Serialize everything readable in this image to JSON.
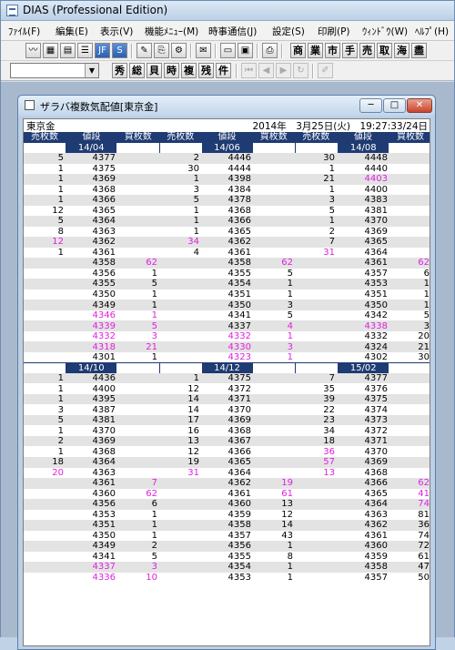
{
  "app": {
    "title": "DIAS (Professional Edition)"
  },
  "menubar": {
    "items": [
      {
        "label": "ﾌｧｲﾙ(F)"
      },
      {
        "label": "編集(E)"
      },
      {
        "label": "表示(V)"
      },
      {
        "label": "機能ﾒﾆｭｰ(M)"
      },
      {
        "label": "時事通信(J)"
      },
      {
        "label": "設定(S)"
      },
      {
        "label": "印刷(P)"
      },
      {
        "label": "ｳｨﾝﾄﾞｳ(W)"
      },
      {
        "label": "ﾍﾙﾌﾟ(H)"
      }
    ]
  },
  "toolbar1": {
    "kanji_buttons": [
      "商",
      "業",
      "市",
      "手",
      "売",
      "取",
      "海",
      "盡"
    ],
    "jf_label": "JF",
    "s_label": "S"
  },
  "toolbar2": {
    "code_value": "",
    "buttons": [
      "秀",
      "総",
      "貝",
      "時",
      "複",
      "残",
      "件"
    ]
  },
  "child_window": {
    "title": "ザラバ複数気配値[東京金]",
    "market": "東京金",
    "timestamp": "2014年　3月25日(火)　19:27:33/24日"
  },
  "headers": {
    "sell": "売枚数",
    "price": "値段",
    "buy": "買枚数"
  },
  "colors": {
    "header_bg": "#1e3b73",
    "stripe": "#e3e3e3",
    "highlight": "#e020e0"
  },
  "blocks": [
    {
      "dates": [
        "14/04",
        "14/06",
        "14/08"
      ],
      "rows": [
        [
          [
            "5",
            "4377",
            ""
          ],
          [
            "2",
            "4446",
            ""
          ],
          [
            "30",
            "4448",
            ""
          ]
        ],
        [
          [
            "1",
            "4375",
            ""
          ],
          [
            "30",
            "4444",
            ""
          ],
          [
            "1",
            "4440",
            ""
          ]
        ],
        [
          [
            "1",
            "4369",
            ""
          ],
          [
            "1",
            "4398",
            ""
          ],
          [
            "21",
            "4403",
            ""
          ]
        ],
        [
          [
            "1",
            "4368",
            ""
          ],
          [
            "3",
            "4384",
            ""
          ],
          [
            "1",
            "4400",
            ""
          ]
        ],
        [
          [
            "1",
            "4366",
            ""
          ],
          [
            "5",
            "4378",
            ""
          ],
          [
            "3",
            "4383",
            ""
          ]
        ],
        [
          [
            "12",
            "4365",
            ""
          ],
          [
            "1",
            "4368",
            ""
          ],
          [
            "5",
            "4381",
            ""
          ]
        ],
        [
          [
            "5",
            "4364",
            ""
          ],
          [
            "1",
            "4366",
            ""
          ],
          [
            "1",
            "4370",
            ""
          ]
        ],
        [
          [
            "8",
            "4363",
            ""
          ],
          [
            "1",
            "4365",
            ""
          ],
          [
            "2",
            "4369",
            ""
          ]
        ],
        [
          [
            "12",
            "4362",
            ""
          ],
          [
            "34",
            "4362",
            ""
          ],
          [
            "7",
            "4365",
            ""
          ]
        ],
        [
          [
            "1",
            "4361",
            ""
          ],
          [
            "4",
            "4361",
            ""
          ],
          [
            "31",
            "4364",
            ""
          ]
        ],
        [
          [
            "",
            "4358",
            "62"
          ],
          [
            "",
            "4358",
            "62"
          ],
          [
            "",
            "4361",
            "62"
          ]
        ],
        [
          [
            "",
            "4356",
            "1"
          ],
          [
            "",
            "4355",
            "5"
          ],
          [
            "",
            "4357",
            "6"
          ]
        ],
        [
          [
            "",
            "4355",
            "5"
          ],
          [
            "",
            "4354",
            "1"
          ],
          [
            "",
            "4353",
            "1"
          ]
        ],
        [
          [
            "",
            "4350",
            "1"
          ],
          [
            "",
            "4351",
            "1"
          ],
          [
            "",
            "4351",
            "1"
          ]
        ],
        [
          [
            "",
            "4349",
            "1"
          ],
          [
            "",
            "4350",
            "3"
          ],
          [
            "",
            "4350",
            "1"
          ]
        ],
        [
          [
            "",
            "4346",
            "1"
          ],
          [
            "",
            "4341",
            "5"
          ],
          [
            "",
            "4342",
            "5"
          ]
        ],
        [
          [
            "",
            "4339",
            "5"
          ],
          [
            "",
            "4337",
            "4"
          ],
          [
            "",
            "4338",
            "3"
          ]
        ],
        [
          [
            "",
            "4332",
            "3"
          ],
          [
            "",
            "4332",
            "1"
          ],
          [
            "",
            "4332",
            "20"
          ]
        ],
        [
          [
            "",
            "4318",
            "21"
          ],
          [
            "",
            "4330",
            "3"
          ],
          [
            "",
            "4324",
            "21"
          ]
        ],
        [
          [
            "",
            "4301",
            "1"
          ],
          [
            "",
            "4323",
            "1"
          ],
          [
            "",
            "4302",
            "30"
          ]
        ]
      ]
    },
    {
      "dates": [
        "14/10",
        "14/12",
        "15/02"
      ],
      "rows": [
        [
          [
            "1",
            "4436",
            ""
          ],
          [
            "1",
            "4375",
            ""
          ],
          [
            "7",
            "4377",
            ""
          ]
        ],
        [
          [
            "1",
            "4400",
            ""
          ],
          [
            "12",
            "4372",
            ""
          ],
          [
            "35",
            "4376",
            ""
          ]
        ],
        [
          [
            "1",
            "4395",
            ""
          ],
          [
            "14",
            "4371",
            ""
          ],
          [
            "39",
            "4375",
            ""
          ]
        ],
        [
          [
            "3",
            "4387",
            ""
          ],
          [
            "14",
            "4370",
            ""
          ],
          [
            "22",
            "4374",
            ""
          ]
        ],
        [
          [
            "5",
            "4381",
            ""
          ],
          [
            "17",
            "4369",
            ""
          ],
          [
            "23",
            "4373",
            ""
          ]
        ],
        [
          [
            "1",
            "4370",
            ""
          ],
          [
            "16",
            "4368",
            ""
          ],
          [
            "34",
            "4372",
            ""
          ]
        ],
        [
          [
            "2",
            "4369",
            ""
          ],
          [
            "13",
            "4367",
            ""
          ],
          [
            "18",
            "4371",
            ""
          ]
        ],
        [
          [
            "1",
            "4368",
            ""
          ],
          [
            "12",
            "4366",
            ""
          ],
          [
            "36",
            "4370",
            ""
          ]
        ],
        [
          [
            "18",
            "4364",
            ""
          ],
          [
            "19",
            "4365",
            ""
          ],
          [
            "57",
            "4369",
            ""
          ]
        ],
        [
          [
            "20",
            "4363",
            ""
          ],
          [
            "31",
            "4364",
            ""
          ],
          [
            "13",
            "4368",
            ""
          ]
        ],
        [
          [
            "",
            "4361",
            "7"
          ],
          [
            "",
            "4362",
            "19"
          ],
          [
            "",
            "4366",
            "62"
          ]
        ],
        [
          [
            "",
            "4360",
            "62"
          ],
          [
            "",
            "4361",
            "61"
          ],
          [
            "",
            "4365",
            "41"
          ]
        ],
        [
          [
            "",
            "4356",
            "6"
          ],
          [
            "",
            "4360",
            "13"
          ],
          [
            "",
            "4364",
            "74"
          ]
        ],
        [
          [
            "",
            "4353",
            "1"
          ],
          [
            "",
            "4359",
            "12"
          ],
          [
            "",
            "4363",
            "81"
          ]
        ],
        [
          [
            "",
            "4351",
            "1"
          ],
          [
            "",
            "4358",
            "14"
          ],
          [
            "",
            "4362",
            "36"
          ]
        ],
        [
          [
            "",
            "4350",
            "1"
          ],
          [
            "",
            "4357",
            "43"
          ],
          [
            "",
            "4361",
            "74"
          ]
        ],
        [
          [
            "",
            "4349",
            "2"
          ],
          [
            "",
            "4356",
            "1"
          ],
          [
            "",
            "4360",
            "72"
          ]
        ],
        [
          [
            "",
            "4341",
            "5"
          ],
          [
            "",
            "4355",
            "8"
          ],
          [
            "",
            "4359",
            "61"
          ]
        ],
        [
          [
            "",
            "4337",
            "3"
          ],
          [
            "",
            "4354",
            "1"
          ],
          [
            "",
            "4358",
            "47"
          ]
        ],
        [
          [
            "",
            "4336",
            "10"
          ],
          [
            "",
            "4353",
            "1"
          ],
          [
            "",
            "4357",
            "50"
          ]
        ]
      ]
    }
  ],
  "highlights": [
    [
      [
        [
          8,
          0,
          "s"
        ],
        [
          15,
          0,
          "p"
        ],
        [
          16,
          0,
          "p"
        ],
        [
          17,
          0,
          "p"
        ],
        [
          18,
          0,
          "p"
        ],
        [
          10,
          0,
          "b"
        ],
        [
          15,
          0,
          "b"
        ],
        [
          16,
          0,
          "b"
        ],
        [
          17,
          0,
          "b"
        ],
        [
          18,
          0,
          "b"
        ],
        [
          8,
          1,
          "s"
        ],
        [
          17,
          1,
          "p"
        ],
        [
          18,
          1,
          "p"
        ],
        [
          19,
          1,
          "p"
        ],
        [
          10,
          1,
          "b"
        ],
        [
          16,
          1,
          "b"
        ],
        [
          17,
          1,
          "b"
        ],
        [
          18,
          1,
          "b"
        ],
        [
          19,
          1,
          "b"
        ],
        [
          9,
          2,
          "s"
        ],
        [
          2,
          2,
          "p"
        ],
        [
          16,
          2,
          "p"
        ],
        [
          10,
          2,
          "b"
        ]
      ]
    ],
    [
      [
        [
          9,
          0,
          "s"
        ],
        [
          18,
          0,
          "p"
        ],
        [
          19,
          0,
          "p"
        ],
        [
          10,
          0,
          "b"
        ],
        [
          11,
          0,
          "b"
        ],
        [
          18,
          0,
          "b"
        ],
        [
          19,
          0,
          "b"
        ],
        [
          9,
          1,
          "s"
        ],
        [
          10,
          1,
          "b"
        ],
        [
          11,
          1,
          "b"
        ],
        [
          7,
          2,
          "s"
        ],
        [
          8,
          2,
          "s"
        ],
        [
          9,
          2,
          "s"
        ],
        [
          10,
          2,
          "b"
        ],
        [
          11,
          2,
          "b"
        ],
        [
          12,
          2,
          "b"
        ]
      ]
    ]
  ]
}
